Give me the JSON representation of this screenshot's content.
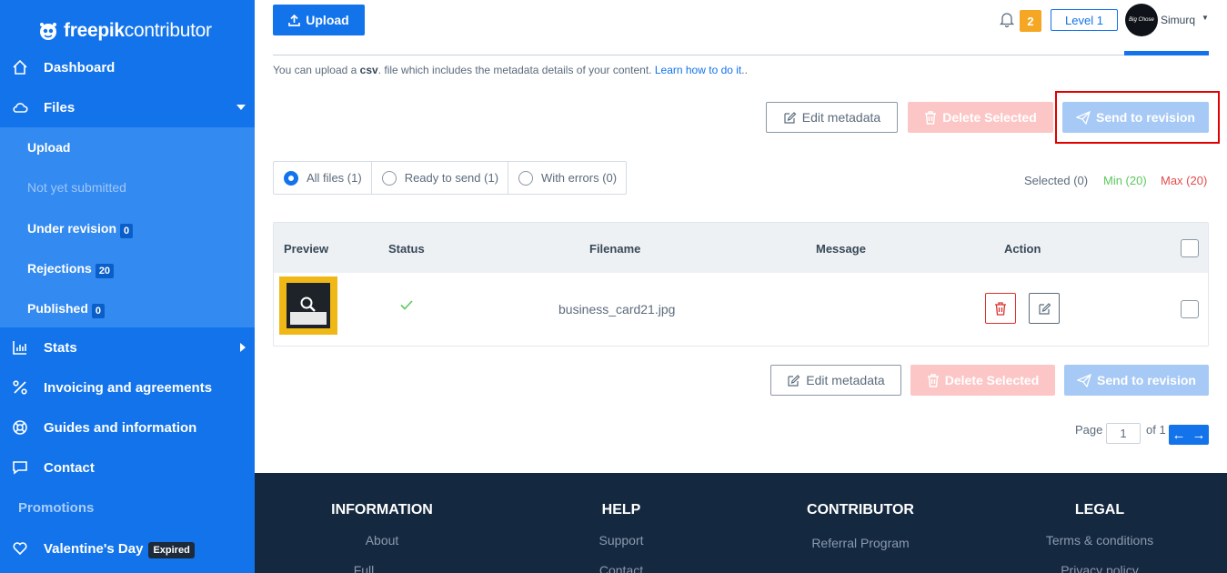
{
  "sidebar": {
    "logo_bold": "freepik",
    "logo_light": "contributor",
    "items": [
      {
        "label": "Dashboard",
        "icon": "home-icon"
      },
      {
        "label": "Files",
        "icon": "cloud-icon"
      },
      {
        "label": "Stats",
        "icon": "bar-chart-icon"
      },
      {
        "label": "Invoicing and agreements",
        "icon": "percent-icon"
      },
      {
        "label": "Guides and information",
        "icon": "lifebuoy-icon"
      },
      {
        "label": "Contact",
        "icon": "chat-icon"
      }
    ],
    "files_submenu": [
      {
        "label": "Upload"
      },
      {
        "label": "Not yet submitted"
      },
      {
        "label": "Under revision",
        "count": "0"
      },
      {
        "label": "Rejections",
        "count": "20"
      },
      {
        "label": "Published",
        "count": "0"
      }
    ],
    "promotions_label": "Promotions",
    "valentines": {
      "label": "Valentine's Day",
      "badge": "Expired"
    }
  },
  "header": {
    "upload_label": "Upload",
    "notification_count": "2",
    "level_label": "Level 1",
    "avatar_text": "Big Chose",
    "username": "Simurq"
  },
  "csv_note": {
    "prefix": "You can upload a ",
    "format": "csv",
    "middle": ". file which includes the metadata details of your content. ",
    "link": "Learn how to do it",
    "suffix": ".."
  },
  "actions": {
    "edit_metadata": "Edit metadata",
    "delete_selected": "Delete Selected",
    "send_to_revision": "Send to revision"
  },
  "filters": [
    {
      "label": "All files (1)",
      "selected": true
    },
    {
      "label": "Ready to send (1)",
      "selected": false
    },
    {
      "label": "With errors (0)",
      "selected": false
    }
  ],
  "selection": {
    "selected": "Selected (0)",
    "min": "Min (20)",
    "max": "Max (20)",
    "min_color": "#5cc85c",
    "max_color": "#e34b4b"
  },
  "table": {
    "columns": [
      "Preview",
      "Status",
      "Filename",
      "Message",
      "Action"
    ],
    "rows": [
      {
        "filename": "business_card21.jpg",
        "status": "check-icon",
        "message": ""
      }
    ]
  },
  "pagination": {
    "page_label": "Page",
    "page_value": "1",
    "of_label": "of 1"
  },
  "footer": {
    "columns": [
      {
        "heading": "INFORMATION",
        "links": [
          "About",
          "Full"
        ]
      },
      {
        "heading": "HELP",
        "links": [
          "Support",
          "Contact"
        ]
      },
      {
        "heading": "CONTRIBUTOR",
        "links": [
          "Referral Program"
        ]
      },
      {
        "heading": "LEGAL",
        "links": [
          "Terms & conditions",
          "Privacy policy"
        ]
      }
    ]
  },
  "colors": {
    "brand_blue": "#1273eb",
    "sidebar_sub": "#338af0",
    "footer_bg": "#14283f",
    "highlight_red": "#e10000"
  }
}
